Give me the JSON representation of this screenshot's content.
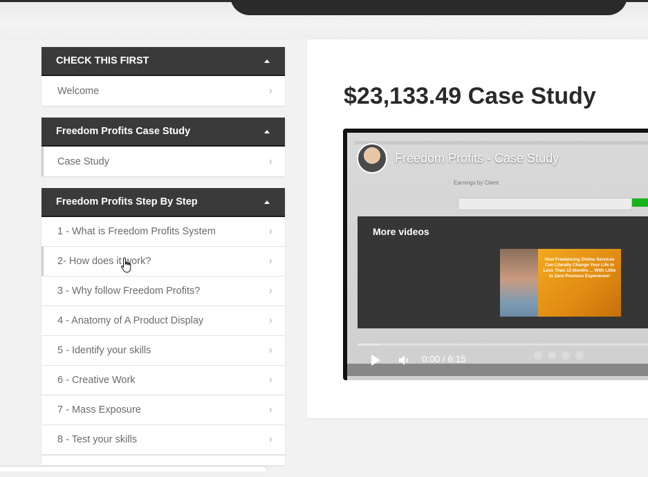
{
  "sidebar": {
    "modules": [
      {
        "title": "CHECK THIS FIRST",
        "lessons": [
          "Welcome"
        ]
      },
      {
        "title": "Freedom Profits Case Study",
        "lessons": [
          "Case Study"
        ]
      },
      {
        "title": "Freedom Profits Step By Step",
        "lessons": [
          "1 - What is Freedom Profits System",
          "2- How does it work?",
          "3 - Why follow Freedom Profits?",
          "4 - Anatomy of A Product Display",
          "5 - Identify your skills",
          "6 - Creative Work",
          "7 - Mass Exposure",
          "8 - Test your skills"
        ]
      }
    ]
  },
  "main": {
    "lesson_title": "$23,133.49 Case Study"
  },
  "video": {
    "title": "Freedom Profits - Case Study",
    "more_videos_label": "More videos",
    "thumbnail_text": "How Freelancing Online Services Can Literally Change Your Life in Less Than 12 Months ... With Little to Zero Previous Experience!",
    "time_display": "0:00 / 6:15",
    "screen_heading": "Earnings by Client",
    "progress_fraction": 0.075
  },
  "icons": {
    "caret": "caret-up-icon",
    "chevron": "chevron-right-icon",
    "play": "play-icon",
    "volume": "volume-icon",
    "cursor": "hand-cursor-icon"
  }
}
